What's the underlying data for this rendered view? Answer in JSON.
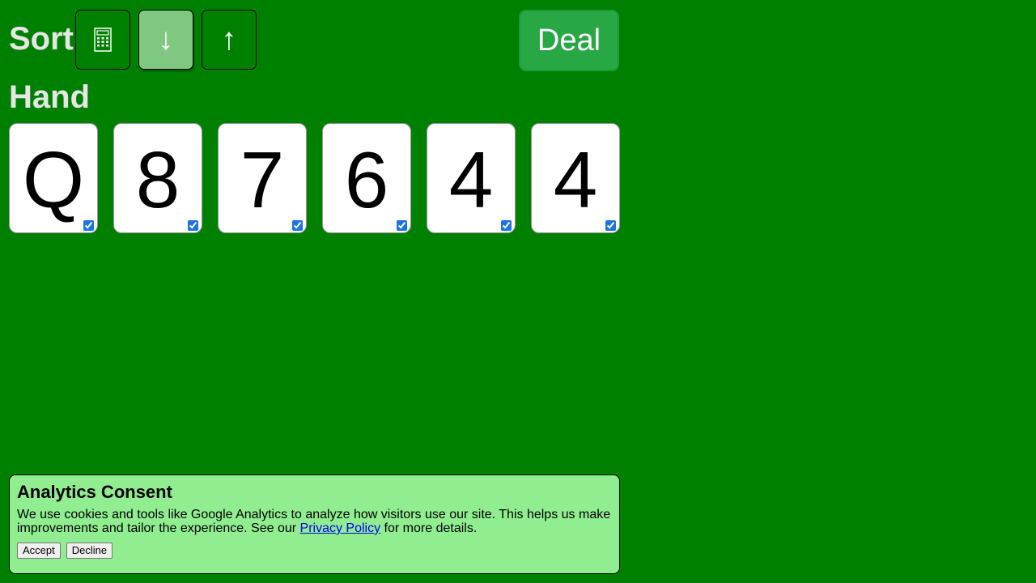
{
  "sort": {
    "title": "Sort",
    "buttons": [
      {
        "icon": "calculator-icon",
        "label": "",
        "active": false
      },
      {
        "icon": "arrow-down-icon",
        "label": "↓",
        "active": true
      },
      {
        "icon": "arrow-up-icon",
        "label": "↑",
        "active": false
      }
    ]
  },
  "deal": {
    "label": "Deal",
    "color": "#28a745"
  },
  "hand": {
    "title": "Hand",
    "cards": [
      {
        "rank": "Q",
        "checked": true
      },
      {
        "rank": "8",
        "checked": true
      },
      {
        "rank": "7",
        "checked": true
      },
      {
        "rank": "6",
        "checked": true
      },
      {
        "rank": "4",
        "checked": true
      },
      {
        "rank": "4",
        "checked": true
      }
    ]
  },
  "consent": {
    "title": "Analytics Consent",
    "text_before": "We use cookies and tools like Google Analytics to analyze how visitors use our site. This helps us make improvements and tailor the experience. See our ",
    "link": "Privacy Policy",
    "text_after": " for more details.",
    "accept_label": "Accept",
    "decline_label": "Decline"
  },
  "colors": {
    "background": "#008000",
    "consent_background": "#90ee90",
    "active_sort": "#80c880"
  }
}
